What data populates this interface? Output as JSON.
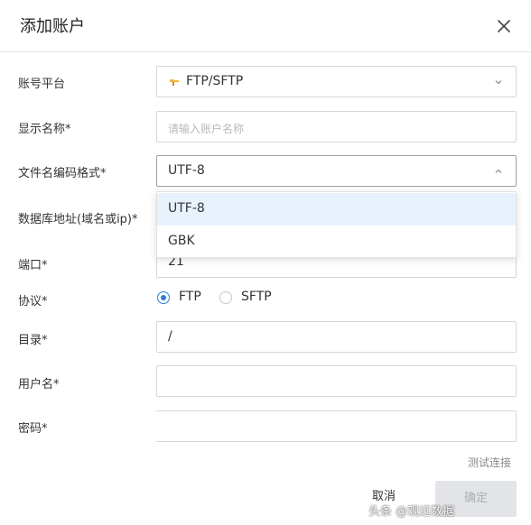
{
  "dialog": {
    "title": "添加账户"
  },
  "fields": {
    "platform": {
      "label": "账号平台",
      "value": "FTP/SFTP"
    },
    "display_name": {
      "label": "显示名称*",
      "placeholder": "请输入账户名称"
    },
    "encoding": {
      "label": "文件名编码格式*",
      "value": "UTF-8",
      "options": [
        "UTF-8",
        "GBK"
      ]
    },
    "host": {
      "label": "数据库地址(域名或ip)*"
    },
    "port": {
      "label": "端口*",
      "value": "21"
    },
    "protocol": {
      "label": "协议*",
      "options": [
        "FTP",
        "SFTP"
      ],
      "selected": "FTP"
    },
    "directory": {
      "label": "目录*",
      "value": "/"
    },
    "username": {
      "label": "用户名*",
      "value": ""
    },
    "password": {
      "label": "密码*",
      "value": ""
    }
  },
  "actions": {
    "test_connection": "测试连接",
    "cancel": "取消",
    "confirm": "确定"
  },
  "watermark": "头条 @观远数据",
  "icons": {
    "close": "close-icon",
    "platform": "ftp-platform-icon",
    "chevron_down": "chevron-down-icon",
    "chevron_up": "chevron-up-icon"
  },
  "colors": {
    "accent": "#2d7cd6",
    "selected_option_bg": "#e8f2fc",
    "disabled_button_bg": "#e2e4e7",
    "disabled_button_text": "#aab0b6",
    "platform_icon": "#f0b43c"
  }
}
